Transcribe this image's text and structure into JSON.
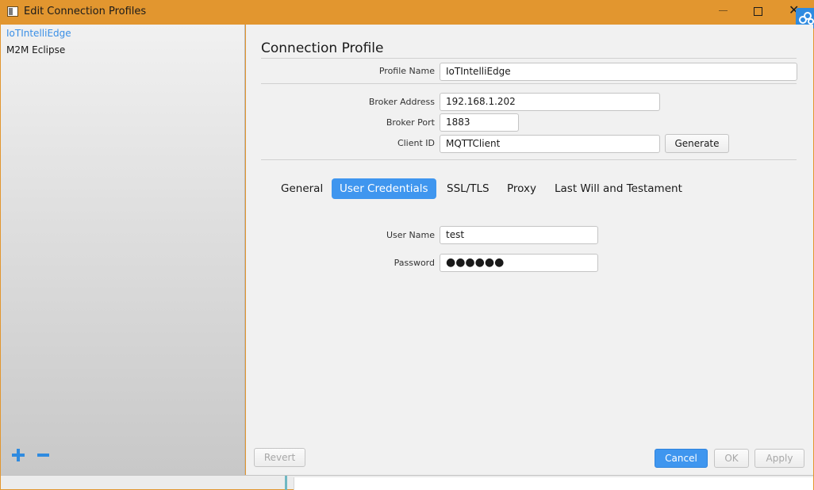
{
  "window": {
    "title": "Edit Connection Profiles"
  },
  "sidebar": {
    "profiles": [
      {
        "label": "IoTIntelliEdge",
        "selected": true
      },
      {
        "label": "M2M Eclipse",
        "selected": false
      }
    ]
  },
  "main": {
    "section_title": "Connection Profile",
    "profile_name": {
      "label": "Profile Name",
      "value": "IoTIntelliEdge"
    },
    "broker_address": {
      "label": "Broker Address",
      "value": "192.168.1.202"
    },
    "broker_port": {
      "label": "Broker Port",
      "value": "1883"
    },
    "client_id": {
      "label": "Client ID",
      "value": "MQTTClient"
    },
    "generate_label": "Generate",
    "tabs": [
      {
        "label": "General",
        "active": false
      },
      {
        "label": "User Credentials",
        "active": true
      },
      {
        "label": "SSL/TLS",
        "active": false
      },
      {
        "label": "Proxy",
        "active": false
      },
      {
        "label": "Last Will and Testament",
        "active": false
      }
    ],
    "user_name": {
      "label": "User Name",
      "value": "test"
    },
    "password": {
      "label": "Password",
      "masked_value": "●●●●●●"
    }
  },
  "footer": {
    "revert_label": "Revert",
    "cancel_label": "Cancel",
    "ok_label": "OK",
    "apply_label": "Apply"
  },
  "colors": {
    "titlebar": "#e2962f",
    "accent": "#3f96ef",
    "selected_text": "#3a8fe6"
  }
}
